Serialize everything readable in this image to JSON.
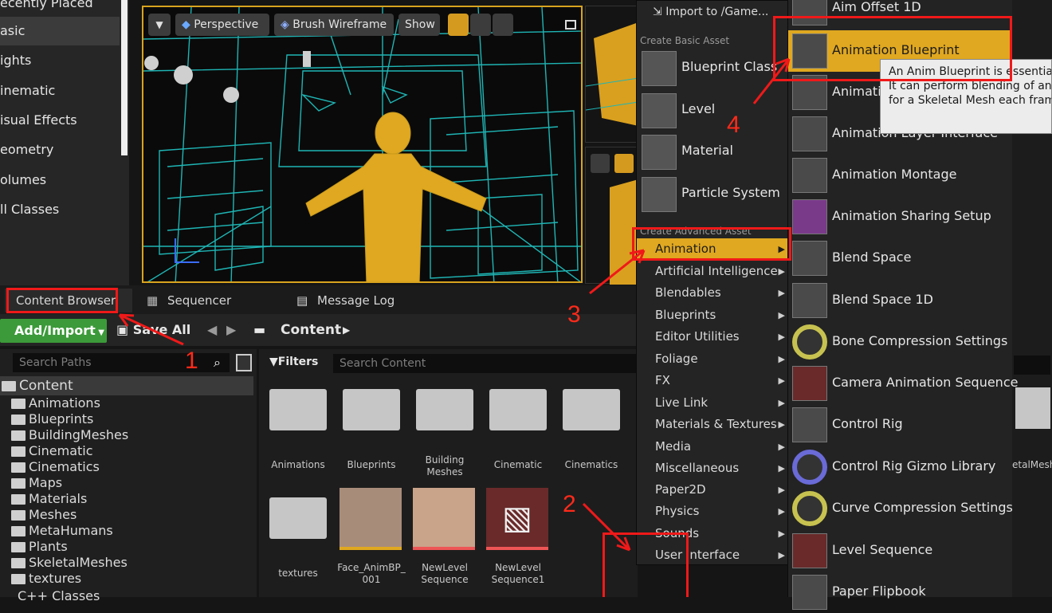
{
  "place_panel": {
    "categories": [
      "ecently Placed",
      "asic",
      "ights",
      "inematic",
      "isual Effects",
      "eometry",
      "olumes",
      "ll Classes"
    ],
    "selected_index": 1
  },
  "viewport": {
    "perspective_label": "Perspective",
    "view_mode_label": "Brush Wireframe",
    "show_label": "Show"
  },
  "tabs": {
    "content_browser": "Content Browser",
    "sequencer": "Sequencer",
    "message_log": "Message Log"
  },
  "toolbar": {
    "add_import": "Add/Import",
    "save_all": "Save All",
    "breadcrumb": "Content"
  },
  "paths": {
    "search_placeholder": "Search Paths",
    "root": "Content",
    "folders": [
      "Animations",
      "Blueprints",
      "BuildingMeshes",
      "Cinematic",
      "Cinematics",
      "Maps",
      "Materials",
      "Meshes",
      "MetaHumans",
      "Plants",
      "SkeletalMeshes",
      "textures"
    ],
    "cpp": "C++ Classes"
  },
  "assets": {
    "filters_label": "Filters",
    "search_placeholder": "Search Content",
    "folder_items": [
      "Animations",
      "Blueprints",
      "Building\nMeshes",
      "Cinematic",
      "Cinematics"
    ],
    "row2": [
      "textures",
      "Face_AnimBP_\n001",
      "NewLevel\nSequence",
      "NewLevel\nSequence1"
    ],
    "partial_right": "etalMesh"
  },
  "menu": {
    "import_label": "Import to /Game...",
    "basic_header": "Create Basic Asset",
    "basic_items": [
      "Blueprint Class",
      "Level",
      "Material",
      "Particle System"
    ],
    "advanced_header": "Create Advanced Asset",
    "advanced_items": [
      "Animation",
      "Artificial Intelligence",
      "Blendables",
      "Blueprints",
      "Editor Utilities",
      "Foliage",
      "FX",
      "Live Link",
      "Materials & Textures",
      "Media",
      "Miscellaneous",
      "Paper2D",
      "Physics",
      "Sounds",
      "User Interface"
    ],
    "selected_advanced": "Animation"
  },
  "submenu": {
    "items": [
      "Aim Offset 1D",
      "Animation Blueprint",
      "Animati",
      "Animation Layer Interface",
      "Animation Montage",
      "Animation Sharing Setup",
      "Blend Space",
      "Blend Space 1D",
      "Bone Compression Settings",
      "Camera Animation Sequence",
      "Control Rig",
      "Control Rig Gizmo Library",
      "Curve Compression Settings",
      "Level Sequence",
      "Paper Flipbook"
    ],
    "highlighted": "Animation Blueprint"
  },
  "tooltip": {
    "line1": "An Anim Blueprint is essential",
    "line2": "It can perform blending of anim",
    "line3": "for a Skeletal Mesh each frame"
  },
  "annotations": {
    "numbers": [
      "1",
      "2",
      "3",
      "4"
    ],
    "color": "#f01919"
  },
  "colors": {
    "accent": "#e0a820",
    "green": "#3c9a3a",
    "wire": "#1fb5b5",
    "character": "#e0a820"
  }
}
